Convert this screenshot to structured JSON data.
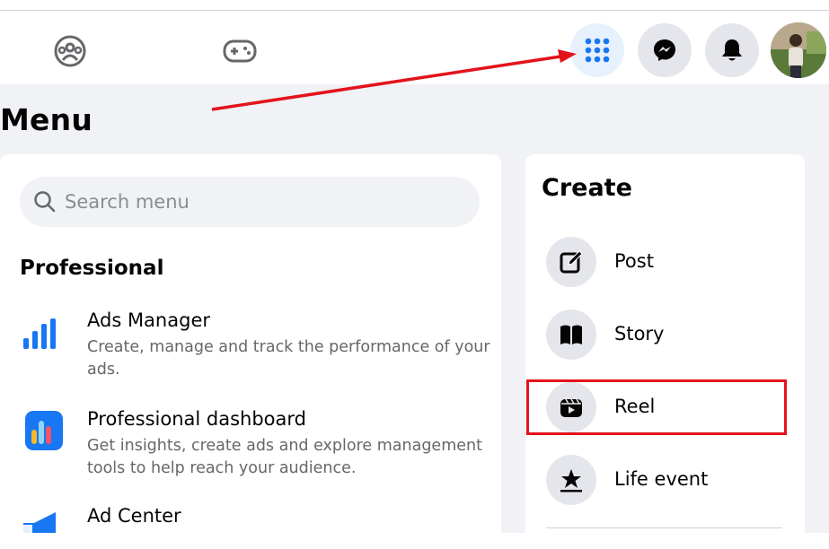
{
  "nav": {
    "left_icons": [
      "groups-icon",
      "gaming-icon"
    ],
    "right_buttons": [
      "menu-grid-icon",
      "messenger-icon",
      "notifications-bell-icon"
    ],
    "active_color": "#1877f2"
  },
  "menu": {
    "title": "Menu",
    "search": {
      "placeholder": "Search menu"
    },
    "professional": {
      "heading": "Professional",
      "items": [
        {
          "icon": "ads-manager-bar-chart-icon",
          "title": "Ads Manager",
          "description": "Create, manage and track the performance of your ads."
        },
        {
          "icon": "professional-dashboard-icon",
          "title": "Professional dashboard",
          "description": "Get insights, create ads and explore management tools to help reach your audience."
        },
        {
          "icon": "megaphone-icon",
          "title": "Ad Center",
          "description": ""
        }
      ]
    }
  },
  "create": {
    "heading": "Create",
    "items": [
      {
        "icon": "edit-post-icon",
        "label": "Post"
      },
      {
        "icon": "story-book-icon",
        "label": "Story"
      },
      {
        "icon": "reel-clapper-icon",
        "label": "Reel"
      },
      {
        "icon": "life-event-star-icon",
        "label": "Life event"
      }
    ],
    "highlighted_item": "Reel"
  },
  "annotations": {
    "arrow_color": "#e3131b",
    "highlight_color": "#e3131b"
  }
}
